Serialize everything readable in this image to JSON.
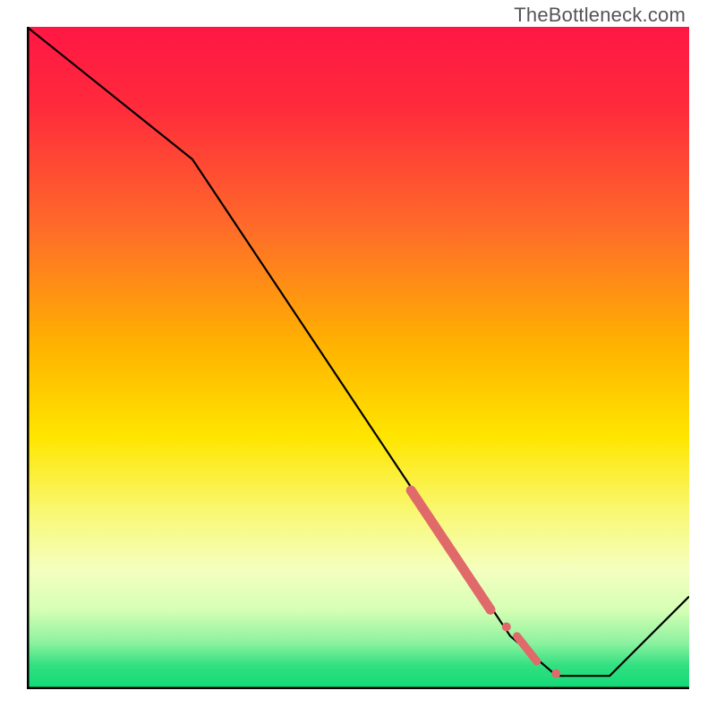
{
  "watermark": "TheBottleneck.com",
  "chart_data": {
    "type": "line",
    "title": "",
    "xlabel": "",
    "ylabel": "",
    "xlim": [
      0,
      100
    ],
    "ylim": [
      0,
      100
    ],
    "x": [
      0,
      25,
      73,
      80,
      88,
      100
    ],
    "values": [
      100,
      80,
      8,
      2,
      2,
      14
    ],
    "note": "Line chart over a vertical heat gradient from red (top) through yellow to green (bottom). The curve drops steeply from upper-left, flattens near the bottom around x≈80–88, then rises again toward the right. Red dashed/dotted highlights mark the segment from x≈58 to x≈80.",
    "highlight_segments": [
      {
        "x0": 58,
        "y0": 30,
        "x1": 70,
        "y1": 12,
        "style": "thick"
      },
      {
        "x0": 72,
        "y0": 10,
        "x1": 72.8,
        "y1": 8.8,
        "style": "dot"
      },
      {
        "x0": 74,
        "y0": 8,
        "x1": 77,
        "y1": 4.2,
        "style": "thick-short"
      },
      {
        "x0": 79.5,
        "y0": 2.5,
        "x1": 80.3,
        "y1": 2.2,
        "style": "dot"
      }
    ],
    "gradient_stops": [
      {
        "offset": 0.0,
        "color": "#ff1744"
      },
      {
        "offset": 0.12,
        "color": "#ff2a3c"
      },
      {
        "offset": 0.3,
        "color": "#ff6a2a"
      },
      {
        "offset": 0.48,
        "color": "#ffb200"
      },
      {
        "offset": 0.62,
        "color": "#ffe600"
      },
      {
        "offset": 0.74,
        "color": "#f8f97a"
      },
      {
        "offset": 0.82,
        "color": "#f4ffbf"
      },
      {
        "offset": 0.88,
        "color": "#d6ffb4"
      },
      {
        "offset": 0.93,
        "color": "#8cf2a0"
      },
      {
        "offset": 0.965,
        "color": "#30e080"
      },
      {
        "offset": 1.0,
        "color": "#12d977"
      }
    ],
    "axis_color": "#000000",
    "line_color": "#000000",
    "highlight_color": "#e06a6a"
  }
}
